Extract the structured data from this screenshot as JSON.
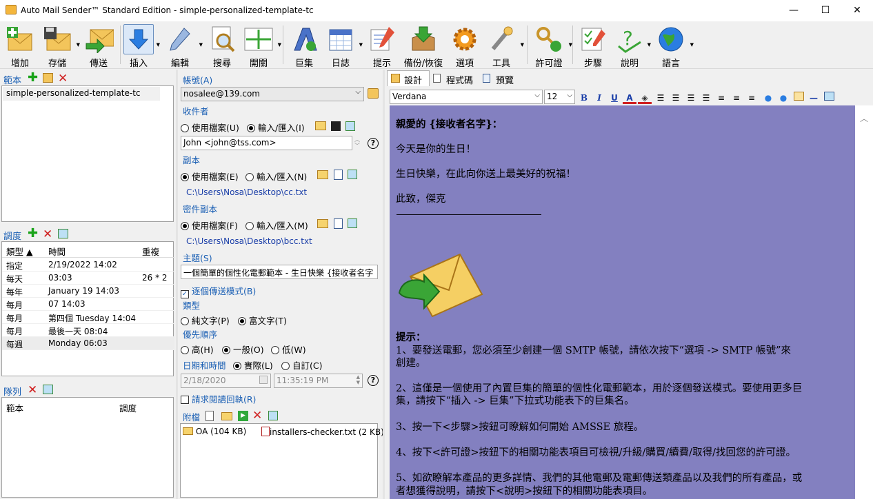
{
  "window": {
    "title": "Auto Mail Sender™ Standard Edition - simple-personalized-template-tc",
    "minimize": "—",
    "maximize": "☐",
    "close": "✕"
  },
  "toolbar": {
    "add": "增加",
    "save": "存儲",
    "send": "傳送",
    "insert": "插入",
    "edit": "編輯",
    "search": "搜尋",
    "open": "開關",
    "macro": "巨集",
    "log": "日誌",
    "hint": "提示",
    "backup": "備份/恢復",
    "options": "選項",
    "tools": "工具",
    "license": "許可證",
    "steps": "步驟",
    "help": "說明",
    "language": "語言"
  },
  "templates": {
    "title": "範本",
    "items": [
      "simple-personalized-template-tc"
    ]
  },
  "schedule": {
    "title": "調度",
    "col_type": "類型 ▲",
    "col_time": "時間",
    "col_repeat": "重複",
    "rows": [
      {
        "type": "指定",
        "time": "2/19/2022 14:02",
        "repeat": ""
      },
      {
        "type": "每天",
        "time": "03:03",
        "repeat": "26 * 2"
      },
      {
        "type": "每年",
        "time": "January 19 14:03",
        "repeat": ""
      },
      {
        "type": "每月",
        "time": "07 14:03",
        "repeat": ""
      },
      {
        "type": "每月",
        "time": "第四個 Tuesday 14:04",
        "repeat": ""
      },
      {
        "type": "每月",
        "time": "最後一天 08:04",
        "repeat": ""
      },
      {
        "type": "每週",
        "time": "Monday 06:03",
        "repeat": ""
      }
    ]
  },
  "queue": {
    "title": "隊列",
    "col_template": "範本",
    "col_schedule": "調度"
  },
  "form": {
    "account_label": "帳號(A)",
    "account_value": "nosalee@139.com",
    "recipient_label": "收件者",
    "use_file": "使用檔案(U)",
    "input_import": "輸入/匯入(I)",
    "recipient_value": "John <john@tss.com>",
    "cc_label": "副本",
    "cc_use_file": "使用檔案(E)",
    "cc_input": "輸入/匯入(N)",
    "cc_path": "C:\\Users\\Nosa\\Desktop\\cc.txt",
    "bcc_label": "密件副本",
    "bcc_use_file": "使用檔案(F)",
    "bcc_input": "輸入/匯入(M)",
    "bcc_path": "C:\\Users\\Nosa\\Desktop\\bcc.txt",
    "subject_label": "主題(S)",
    "subject_value": "一個簡單的個性化電郵範本 - 生日快樂 {接收者名字",
    "send_one_by_one": "逐個傳送模式(B)",
    "type_label": "類型",
    "plain_text": "純文字(P)",
    "rich_text": "富文字(T)",
    "priority_label": "優先順序",
    "high": "高(H)",
    "normal": "一般(O)",
    "low": "低(W)",
    "datetime_label": "日期和時間",
    "actual": "實際(L)",
    "custom": "自訂(C)",
    "date_value": "2/18/2020",
    "time_value": "11:35:19 PM",
    "read_receipt": "請求閱讀回執(R)",
    "attach_label": "附檔",
    "attachments": [
      "OA (104 KB)",
      "installers-checker.txt (2 KB)"
    ]
  },
  "editor": {
    "tab_design": "設計",
    "tab_code": "程式碼",
    "tab_preview": "預覽",
    "font": "Verdana",
    "size": "12",
    "bg_color": "#8380c0",
    "greeting": "親愛的 {接收者名字}：",
    "line1": "今天是你的生日！",
    "line2": "生日快樂，在此向你送上最美好的祝福！",
    "line3": "此致，傑克",
    "tips_title": "提示：",
    "tip1a": "1、要發送電郵，您必須至少創建一個 SMTP 帳號，請依次按下“選項 -> SMTP 帳號”來",
    "tip1b": "創建。",
    "tip2a": "2、這僅是一個使用了內置巨集的簡單的個性化電郵範本，用於逐個發送模式。要使用更多巨",
    "tip2b": "集，請按下“插入 -> 巨集”下拉式功能表下的巨集名。",
    "tip3": "3、按一下<步驟>按鈕可瞭解如何開始 AMSSE 旅程。",
    "tip4": "4、按下<許可證>按鈕下的相關功能表項目可檢視/升級/購買/續費/取得/找回您的許可證。",
    "tip5a": "5、如欲瞭解本產品的更多詳情、我們的其他電郵及電郵傳送類產品以及我們的所有產品，或",
    "tip5b": "者想獲得說明，請按下<說明>按鈕下的相關功能表項目。"
  }
}
